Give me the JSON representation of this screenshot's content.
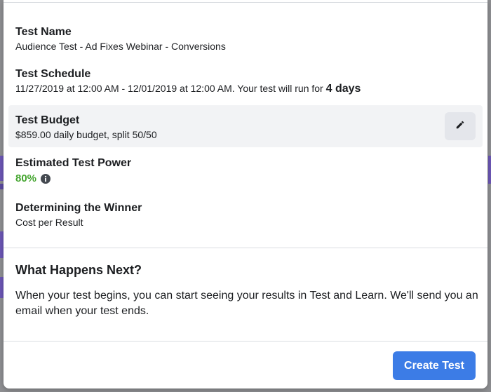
{
  "test_name": {
    "label": "Test Name",
    "value": "Audience Test - Ad Fixes Webinar - Conversions"
  },
  "test_schedule": {
    "label": "Test Schedule",
    "value_prefix": "11/27/2019 at 12:00 AM - 12/01/2019 at 12:00 AM. Your test will run for",
    "duration": "4 days"
  },
  "test_budget": {
    "label": "Test Budget",
    "value": "$859.00 daily budget, split 50/50",
    "edit_icon": "pencil-icon"
  },
  "estimated_power": {
    "label": "Estimated Test Power",
    "value": "80%",
    "info_icon": "info-icon",
    "value_color": "#44a52f"
  },
  "winner": {
    "label": "Determining the Winner",
    "value": "Cost per Result"
  },
  "next": {
    "title": "What Happens Next?",
    "body": "When your test begins, you can start seeing your results in Test and Learn. We'll send you an email when your test ends."
  },
  "footer": {
    "create_label": "Create Test",
    "accent": "#3c7ce6"
  }
}
